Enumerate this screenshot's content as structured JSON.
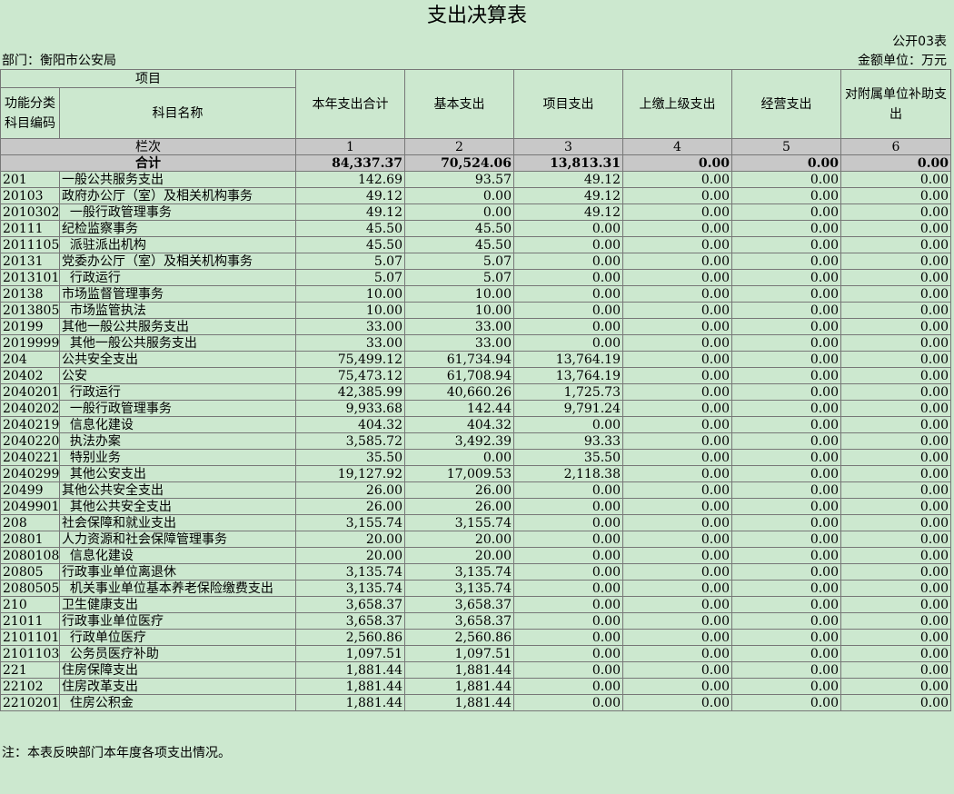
{
  "title": "支出决算表",
  "form_no": "公开03表",
  "department": "部门：衡阳市公安局",
  "unit": "金额单位：万元",
  "header": {
    "item": "项目",
    "func_code": "功能分类科目编码",
    "subject_name": "科目名称",
    "columns": [
      "本年支出合计",
      "基本支出",
      "项目支出",
      "上缴上级支出",
      "经营支出",
      "对附属单位补助支出"
    ]
  },
  "col_index_label": "栏次",
  "col_numbers": [
    "1",
    "2",
    "3",
    "4",
    "5",
    "6"
  ],
  "total": {
    "label": "合计",
    "values": [
      "84,337.37",
      "70,524.06",
      "13,813.31",
      "0.00",
      "0.00",
      "0.00"
    ]
  },
  "rows": [
    {
      "code": "201",
      "name": "一般公共服务支出",
      "values": [
        "142.69",
        "93.57",
        "49.12",
        "0.00",
        "0.00",
        "0.00"
      ]
    },
    {
      "code": "20103",
      "name": "政府办公厅（室）及相关机构事务",
      "values": [
        "49.12",
        "0.00",
        "49.12",
        "0.00",
        "0.00",
        "0.00"
      ]
    },
    {
      "code": "2010302",
      "name": "  一般行政管理事务",
      "values": [
        "49.12",
        "0.00",
        "49.12",
        "0.00",
        "0.00",
        "0.00"
      ]
    },
    {
      "code": "20111",
      "name": "纪检监察事务",
      "values": [
        "45.50",
        "45.50",
        "0.00",
        "0.00",
        "0.00",
        "0.00"
      ]
    },
    {
      "code": "2011105",
      "name": "  派驻派出机构",
      "values": [
        "45.50",
        "45.50",
        "0.00",
        "0.00",
        "0.00",
        "0.00"
      ]
    },
    {
      "code": "20131",
      "name": "党委办公厅（室）及相关机构事务",
      "values": [
        "5.07",
        "5.07",
        "0.00",
        "0.00",
        "0.00",
        "0.00"
      ]
    },
    {
      "code": "2013101",
      "name": "  行政运行",
      "values": [
        "5.07",
        "5.07",
        "0.00",
        "0.00",
        "0.00",
        "0.00"
      ]
    },
    {
      "code": "20138",
      "name": "市场监督管理事务",
      "values": [
        "10.00",
        "10.00",
        "0.00",
        "0.00",
        "0.00",
        "0.00"
      ]
    },
    {
      "code": "2013805",
      "name": "  市场监管执法",
      "values": [
        "10.00",
        "10.00",
        "0.00",
        "0.00",
        "0.00",
        "0.00"
      ]
    },
    {
      "code": "20199",
      "name": "其他一般公共服务支出",
      "values": [
        "33.00",
        "33.00",
        "0.00",
        "0.00",
        "0.00",
        "0.00"
      ]
    },
    {
      "code": "2019999",
      "name": "  其他一般公共服务支出",
      "values": [
        "33.00",
        "33.00",
        "0.00",
        "0.00",
        "0.00",
        "0.00"
      ]
    },
    {
      "code": "204",
      "name": "公共安全支出",
      "values": [
        "75,499.12",
        "61,734.94",
        "13,764.19",
        "0.00",
        "0.00",
        "0.00"
      ]
    },
    {
      "code": "20402",
      "name": "公安",
      "values": [
        "75,473.12",
        "61,708.94",
        "13,764.19",
        "0.00",
        "0.00",
        "0.00"
      ]
    },
    {
      "code": "2040201",
      "name": "  行政运行",
      "values": [
        "42,385.99",
        "40,660.26",
        "1,725.73",
        "0.00",
        "0.00",
        "0.00"
      ]
    },
    {
      "code": "2040202",
      "name": "  一般行政管理事务",
      "values": [
        "9,933.68",
        "142.44",
        "9,791.24",
        "0.00",
        "0.00",
        "0.00"
      ]
    },
    {
      "code": "2040219",
      "name": "  信息化建设",
      "values": [
        "404.32",
        "404.32",
        "0.00",
        "0.00",
        "0.00",
        "0.00"
      ]
    },
    {
      "code": "2040220",
      "name": "  执法办案",
      "values": [
        "3,585.72",
        "3,492.39",
        "93.33",
        "0.00",
        "0.00",
        "0.00"
      ]
    },
    {
      "code": "2040221",
      "name": "  特别业务",
      "values": [
        "35.50",
        "0.00",
        "35.50",
        "0.00",
        "0.00",
        "0.00"
      ]
    },
    {
      "code": "2040299",
      "name": "  其他公安支出",
      "values": [
        "19,127.92",
        "17,009.53",
        "2,118.38",
        "0.00",
        "0.00",
        "0.00"
      ]
    },
    {
      "code": "20499",
      "name": "其他公共安全支出",
      "values": [
        "26.00",
        "26.00",
        "0.00",
        "0.00",
        "0.00",
        "0.00"
      ]
    },
    {
      "code": "2049901",
      "name": "  其他公共安全支出",
      "values": [
        "26.00",
        "26.00",
        "0.00",
        "0.00",
        "0.00",
        "0.00"
      ]
    },
    {
      "code": "208",
      "name": "社会保障和就业支出",
      "values": [
        "3,155.74",
        "3,155.74",
        "0.00",
        "0.00",
        "0.00",
        "0.00"
      ]
    },
    {
      "code": "20801",
      "name": "人力资源和社会保障管理事务",
      "values": [
        "20.00",
        "20.00",
        "0.00",
        "0.00",
        "0.00",
        "0.00"
      ]
    },
    {
      "code": "2080108",
      "name": "  信息化建设",
      "values": [
        "20.00",
        "20.00",
        "0.00",
        "0.00",
        "0.00",
        "0.00"
      ]
    },
    {
      "code": "20805",
      "name": "行政事业单位离退休",
      "values": [
        "3,135.74",
        "3,135.74",
        "0.00",
        "0.00",
        "0.00",
        "0.00"
      ]
    },
    {
      "code": "2080505",
      "name": "  机关事业单位基本养老保险缴费支出",
      "values": [
        "3,135.74",
        "3,135.74",
        "0.00",
        "0.00",
        "0.00",
        "0.00"
      ]
    },
    {
      "code": "210",
      "name": "卫生健康支出",
      "values": [
        "3,658.37",
        "3,658.37",
        "0.00",
        "0.00",
        "0.00",
        "0.00"
      ]
    },
    {
      "code": "21011",
      "name": "行政事业单位医疗",
      "values": [
        "3,658.37",
        "3,658.37",
        "0.00",
        "0.00",
        "0.00",
        "0.00"
      ]
    },
    {
      "code": "2101101",
      "name": "  行政单位医疗",
      "values": [
        "2,560.86",
        "2,560.86",
        "0.00",
        "0.00",
        "0.00",
        "0.00"
      ]
    },
    {
      "code": "2101103",
      "name": "  公务员医疗补助",
      "values": [
        "1,097.51",
        "1,097.51",
        "0.00",
        "0.00",
        "0.00",
        "0.00"
      ]
    },
    {
      "code": "221",
      "name": "住房保障支出",
      "values": [
        "1,881.44",
        "1,881.44",
        "0.00",
        "0.00",
        "0.00",
        "0.00"
      ]
    },
    {
      "code": "22102",
      "name": "住房改革支出",
      "values": [
        "1,881.44",
        "1,881.44",
        "0.00",
        "0.00",
        "0.00",
        "0.00"
      ]
    },
    {
      "code": "2210201",
      "name": "  住房公积金",
      "values": [
        "1,881.44",
        "1,881.44",
        "0.00",
        "0.00",
        "0.00",
        "0.00"
      ]
    }
  ],
  "note": "注：本表反映部门本年度各项支出情况。"
}
